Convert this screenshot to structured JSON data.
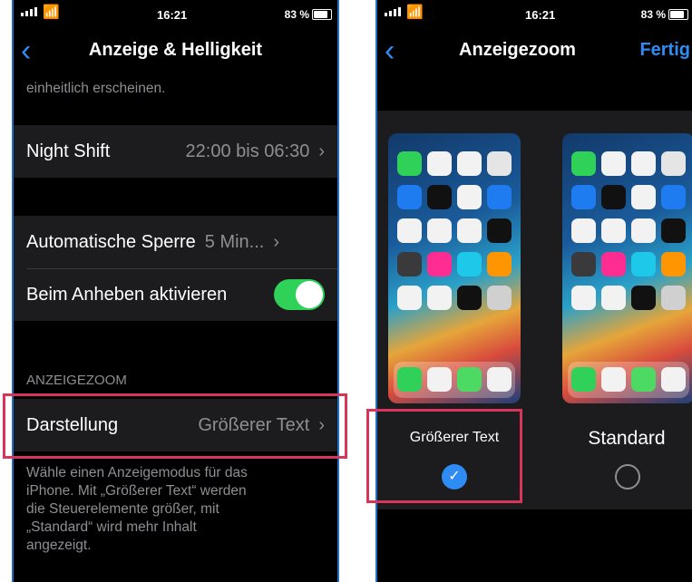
{
  "left_phone": {
    "status": {
      "time": "16:21",
      "battery": "83 %"
    },
    "nav": {
      "back_icon": "chevron-left-icon",
      "title": "Anzeige & Helligkeit"
    },
    "top_text": "einheitlich erscheinen.",
    "night_shift": {
      "label": "Night Shift",
      "value": "22:00 bis 06:30"
    },
    "auto_lock": {
      "label": "Automatische Sperre",
      "value": "5 Min..."
    },
    "raise_to_wake": {
      "label": "Beim Anheben aktivieren",
      "enabled": true
    },
    "section_header": "ANZEIGEZOOM",
    "display_mode": {
      "label": "Darstellung",
      "value": "Größerer Text"
    },
    "footer": [
      "Wähle einen Anzeigemodus für das",
      "iPhone. Mit „Größerer Text“ werden",
      "die Steuerelemente größer, mit",
      "„Standard“ wird mehr Inhalt",
      "angezeigt."
    ]
  },
  "right_phone": {
    "status": {
      "time": "16:21",
      "battery": "83 %"
    },
    "nav": {
      "back_icon": "chevron-left-icon",
      "title": "Anzeigezoom",
      "done": "Fertig"
    },
    "options": [
      {
        "label": "Größerer Text",
        "selected": true
      },
      {
        "label": "Standard",
        "selected": false
      }
    ]
  },
  "colors": {
    "accent": "#2f8cf5",
    "toggle_on": "#30d158",
    "highlight": "#d7355a",
    "cell": "#1c1c1e"
  }
}
